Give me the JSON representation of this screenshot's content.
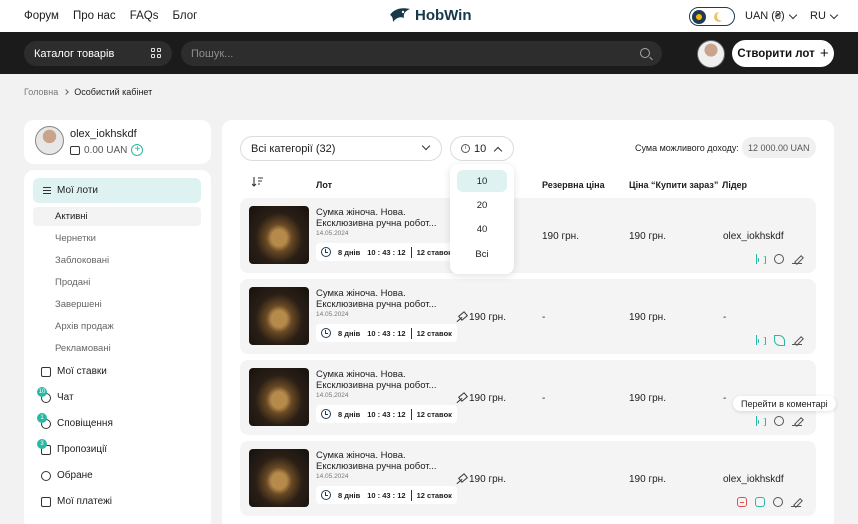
{
  "topnav": {
    "links": [
      "Форум",
      "Про нас",
      "FAQs",
      "Блог"
    ],
    "logo": "HobWin",
    "currency": "UAN (₴)",
    "language": "RU"
  },
  "searchbar": {
    "catalog_label": "Каталог товарів",
    "search_placeholder": "Пошук...",
    "create_label": "Створити лот"
  },
  "breadcrumb": {
    "home": "Головна",
    "current": "Особистий кабінет"
  },
  "user": {
    "name": "olex_iokhskdf",
    "balance": "0.00 UAN"
  },
  "sidebar": {
    "main_label": "Мої лоти",
    "sub_items": [
      "Активні",
      "Чернетки",
      "Заблоковані",
      "Продані",
      "Завершені",
      "Архів продаж",
      "Рекламовані"
    ],
    "items": [
      {
        "label": "Мої ставки",
        "badge": ""
      },
      {
        "label": "Чат",
        "badge": "10"
      },
      {
        "label": "Сповіщення",
        "badge": "1"
      },
      {
        "label": "Пропозиції",
        "badge": "3"
      },
      {
        "label": "Обране",
        "badge": ""
      },
      {
        "label": "Мої платежі",
        "badge": ""
      }
    ]
  },
  "filters": {
    "category": "Всі категорії (32)",
    "count": "10",
    "count_options": [
      "10",
      "20",
      "40",
      "Всі"
    ],
    "income_label": "Сума можливого доходу:",
    "income_value": "12 000.00 UAN"
  },
  "table": {
    "headers": {
      "lot": "Лот",
      "reserve": "Резервна ціна",
      "buy_now": "Ціна “Купити зараз”",
      "leader": "Лідер"
    },
    "rows": [
      {
        "title": "Сумка жіноча. Нова. Ексклюзивна ручна робот...",
        "date": "14.05.2024",
        "days": "8 днів",
        "time": "10 : 43 : 12",
        "bids": "12 ставок",
        "current": "",
        "reserve": "190 грн.",
        "buy_now": "190 грн.",
        "leader": "olex_iokhskdf"
      },
      {
        "title": "Сумка жіноча. Нова. Ексклюзивна ручна робот...",
        "date": "14.05.2024",
        "days": "8 днів",
        "time": "10 : 43 : 12",
        "bids": "12 ставок",
        "current": "190 грн.",
        "reserve": "-",
        "buy_now": "190 грн.",
        "leader": "-"
      },
      {
        "title": "Сумка жіноча. Нова. Ексклюзивна ручна робот...",
        "date": "14.05.2024",
        "days": "8 днів",
        "time": "10 : 43 : 12",
        "bids": "12 ставок",
        "current": "190 грн.",
        "reserve": "-",
        "buy_now": "190 грн.",
        "leader": "-"
      },
      {
        "title": "Сумка жіноча. Нова. Ексклюзивна ручна робот...",
        "date": "14.05.2024",
        "days": "8 днів",
        "time": "10 : 43 : 12",
        "bids": "12 ставок",
        "current": "190 грн.",
        "reserve": "",
        "buy_now": "190 грн.",
        "leader": "olex_iokhskdf"
      }
    ]
  },
  "tooltip": "Перейти в коментарі",
  "colors": {
    "accent": "#2bb8a2",
    "dark_bar": "#1b1b1b",
    "active_bg": "#dff2f2"
  }
}
